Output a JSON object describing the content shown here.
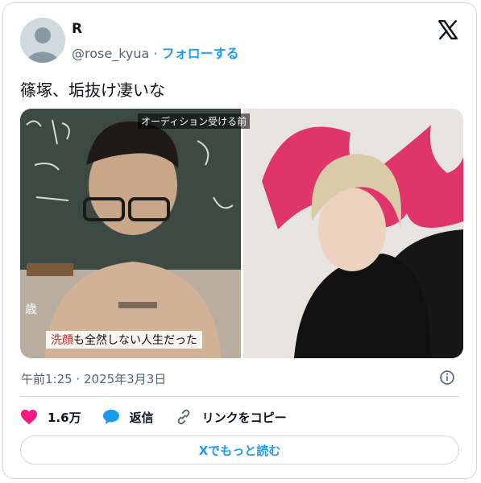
{
  "author": {
    "name": "R",
    "handle": "@rose_kyua",
    "separator": "·",
    "follow": "フォローする"
  },
  "tweet": {
    "text": "篠塚、垢抜け凄いな"
  },
  "media": {
    "left_caption": "オーディション受ける前",
    "age_label": "歳",
    "subtitle_highlight": "洗顔",
    "subtitle_rest": "も全然しない人生だった"
  },
  "meta": {
    "timestamp": "午前1:25 · 2025年3月3日"
  },
  "actions": {
    "likes": "1.6万",
    "reply": "返信",
    "copy_link": "リンクをコピー"
  },
  "read_more": "Xでもっと読む",
  "colors": {
    "accent": "#1d9bf0",
    "like": "#f91880",
    "text": "#0f1419",
    "muted": "#536471",
    "border": "#cfd9de"
  }
}
